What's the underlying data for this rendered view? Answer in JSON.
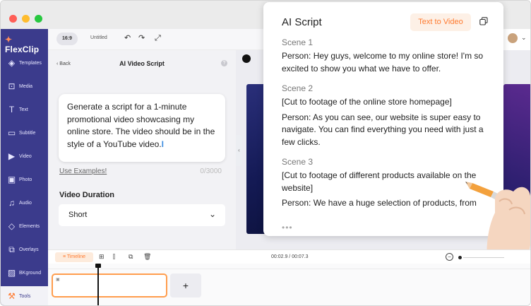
{
  "app": {
    "logo": "FlexClip"
  },
  "sidebar": {
    "items": [
      {
        "label": "Templates",
        "icon": "layers-icon"
      },
      {
        "label": "Media",
        "icon": "media-icon"
      },
      {
        "label": "Text",
        "icon": "text-icon"
      },
      {
        "label": "Subtitle",
        "icon": "subtitle-icon"
      },
      {
        "label": "Video",
        "icon": "video-icon"
      },
      {
        "label": "Photo",
        "icon": "photo-icon"
      },
      {
        "label": "Audio",
        "icon": "audio-icon"
      },
      {
        "label": "Elements",
        "icon": "elements-icon"
      },
      {
        "label": "Overlays",
        "icon": "overlays-icon"
      },
      {
        "label": "BKground",
        "icon": "background-icon"
      },
      {
        "label": "Tools",
        "icon": "tools-icon",
        "active": true
      }
    ]
  },
  "toolbar": {
    "ratio": "16:9",
    "project_name": "Untitled"
  },
  "panel": {
    "back_label": "Back",
    "title": "AI Video Script",
    "prompt_text": "Generate a script for a 1-minute promotional video showcasing my online store. The video should be in the style of a YouTube video.",
    "use_examples": "Use Examples!",
    "char_count": "0/3000",
    "duration_label": "Video Duration",
    "duration_value": "Short"
  },
  "ai_script": {
    "title": "AI Script",
    "text_to_video_label": "Text to Video",
    "scenes": [
      {
        "heading": "Scene 1",
        "lines": [
          "Person: Hey guys, welcome to my online store! I'm so excited to show you what we have to offer."
        ]
      },
      {
        "heading": "Scene 2",
        "lines": [
          "[Cut to footage of the online store homepage]",
          "Person: As you can see, our website is super easy to navigate. You can find everything you need with just a few clicks."
        ]
      },
      {
        "heading": "Scene 3",
        "lines": [
          "[Cut to footage of different products available on the website]",
          "Person: We have a huge selection of products, from"
        ]
      }
    ],
    "typing_indicator": "•••"
  },
  "timeline": {
    "label": "Timeline",
    "time": "00:02.9 / 00:07.3",
    "add_label": "+"
  },
  "colors": {
    "brand_purple": "#3b3b8c",
    "accent_orange": "#ff7a2f"
  }
}
